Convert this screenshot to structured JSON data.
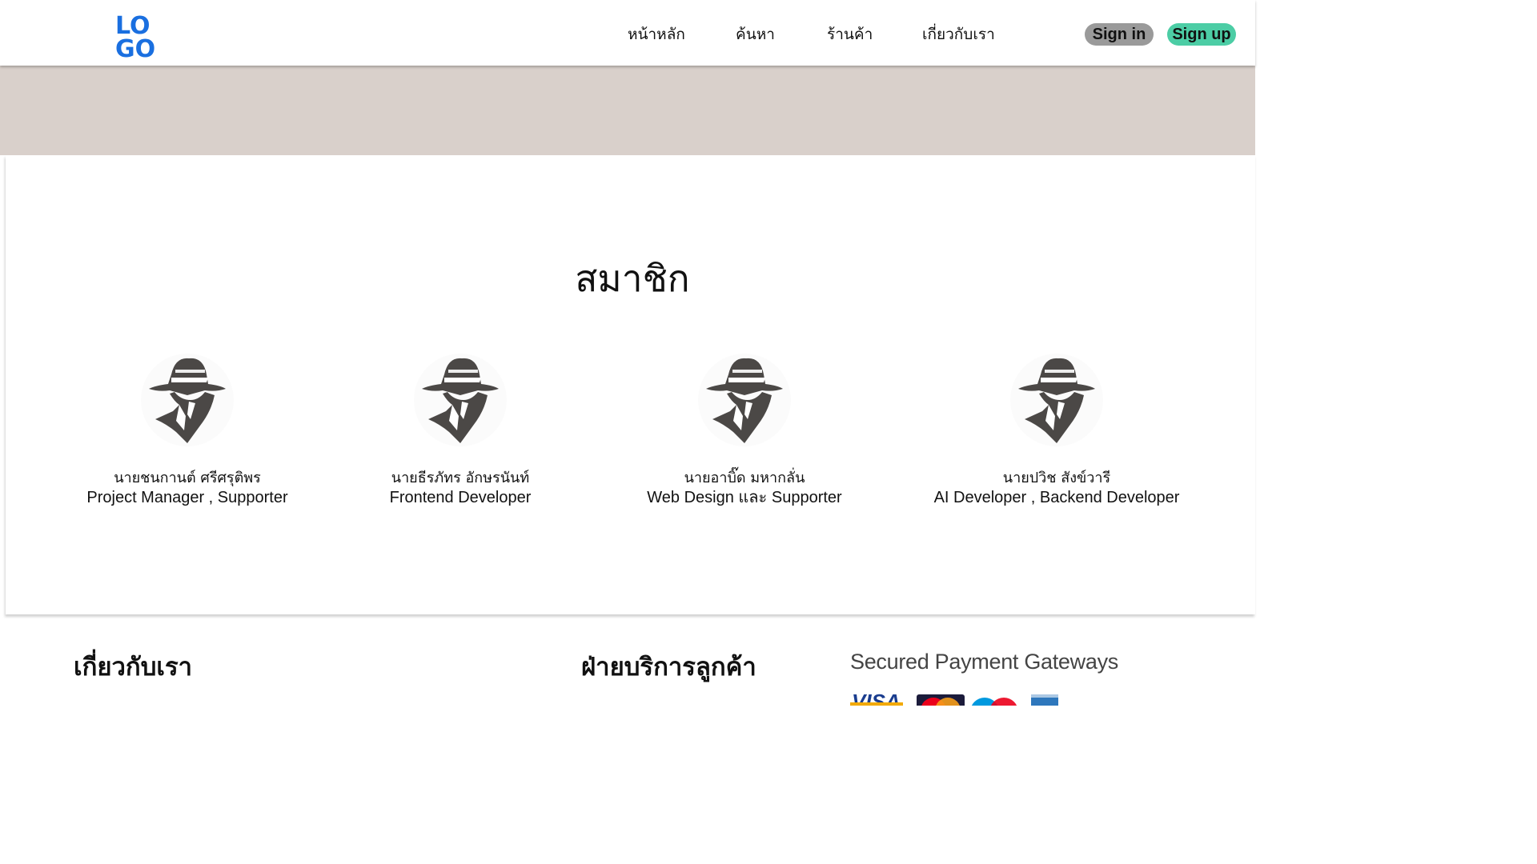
{
  "header": {
    "logo_text": [
      "LO",
      "GO"
    ],
    "nav": [
      {
        "label": "หน้าหลัก"
      },
      {
        "label": "ค้นหา"
      },
      {
        "label": "ร้านค้า"
      },
      {
        "label": "เกี่ยวกับเรา"
      }
    ],
    "signin_label": "Sign in",
    "signup_label": "Sign up",
    "colors": {
      "logo": "#1a6fe0",
      "signin_bg": "#9a9a9a",
      "signup_bg": "#4ccda5"
    }
  },
  "banner": {
    "color": "#d9d0cb"
  },
  "members": {
    "title": "สมาชิก",
    "list": [
      {
        "name": "นายชนกานต์ ศรีศรุติพร",
        "role": "Project Manager , Supporter",
        "avatar_icon": "detective-icon"
      },
      {
        "name": "นายธีรภัทร อักษรนันท์",
        "role": "Frontend Developer",
        "avatar_icon": "detective-icon"
      },
      {
        "name": "นายอาบิ๊ด มหากลั่น",
        "role": "Web Design และ Supporter",
        "avatar_icon": "detective-icon"
      },
      {
        "name": "นายปวิช สังข์วารี",
        "role": "AI Developer , Backend Developer",
        "avatar_icon": "detective-icon"
      }
    ]
  },
  "footer": {
    "about_heading": "เกี่ยวกับเรา",
    "service_heading": "ฝ่ายบริการลูกค้า",
    "payment_heading": "Secured Payment Gateways",
    "payment_icons": [
      "visa-icon",
      "mastercard-icon",
      "maestro-icon",
      "amex-icon"
    ]
  }
}
